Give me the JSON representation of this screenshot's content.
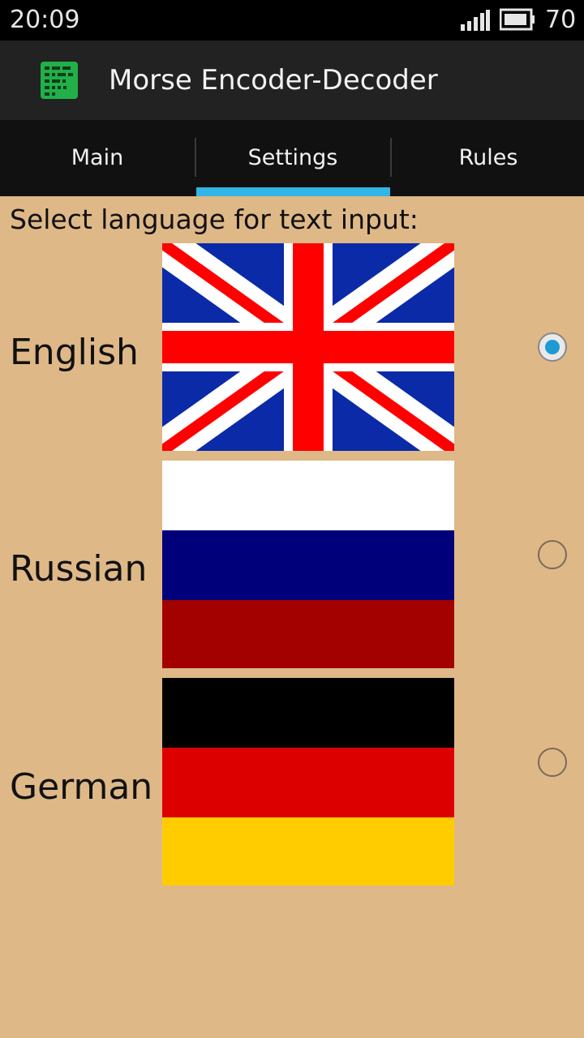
{
  "status_bar": {
    "time": "20:09",
    "battery_level": "70",
    "icons": [
      "signal-icon",
      "battery-icon"
    ]
  },
  "action_bar": {
    "app_icon": "morse-app-icon",
    "title": "Morse Encoder-Decoder"
  },
  "tabs": [
    {
      "label": "Main",
      "selected": false
    },
    {
      "label": "Settings",
      "selected": true
    },
    {
      "label": "Rules",
      "selected": false
    }
  ],
  "colors": {
    "background": "#dfb888",
    "tab_indicator": "#33b5e5",
    "radio_selected": "#1e9bd3"
  },
  "settings": {
    "prompt": "Select language for text input:",
    "languages": [
      {
        "name": "English",
        "flag": "uk-flag-image",
        "selected": true
      },
      {
        "name": "Russian",
        "flag": "russia-flag-image",
        "selected": false
      },
      {
        "name": "German",
        "flag": "germany-flag-image",
        "selected": false
      }
    ]
  }
}
